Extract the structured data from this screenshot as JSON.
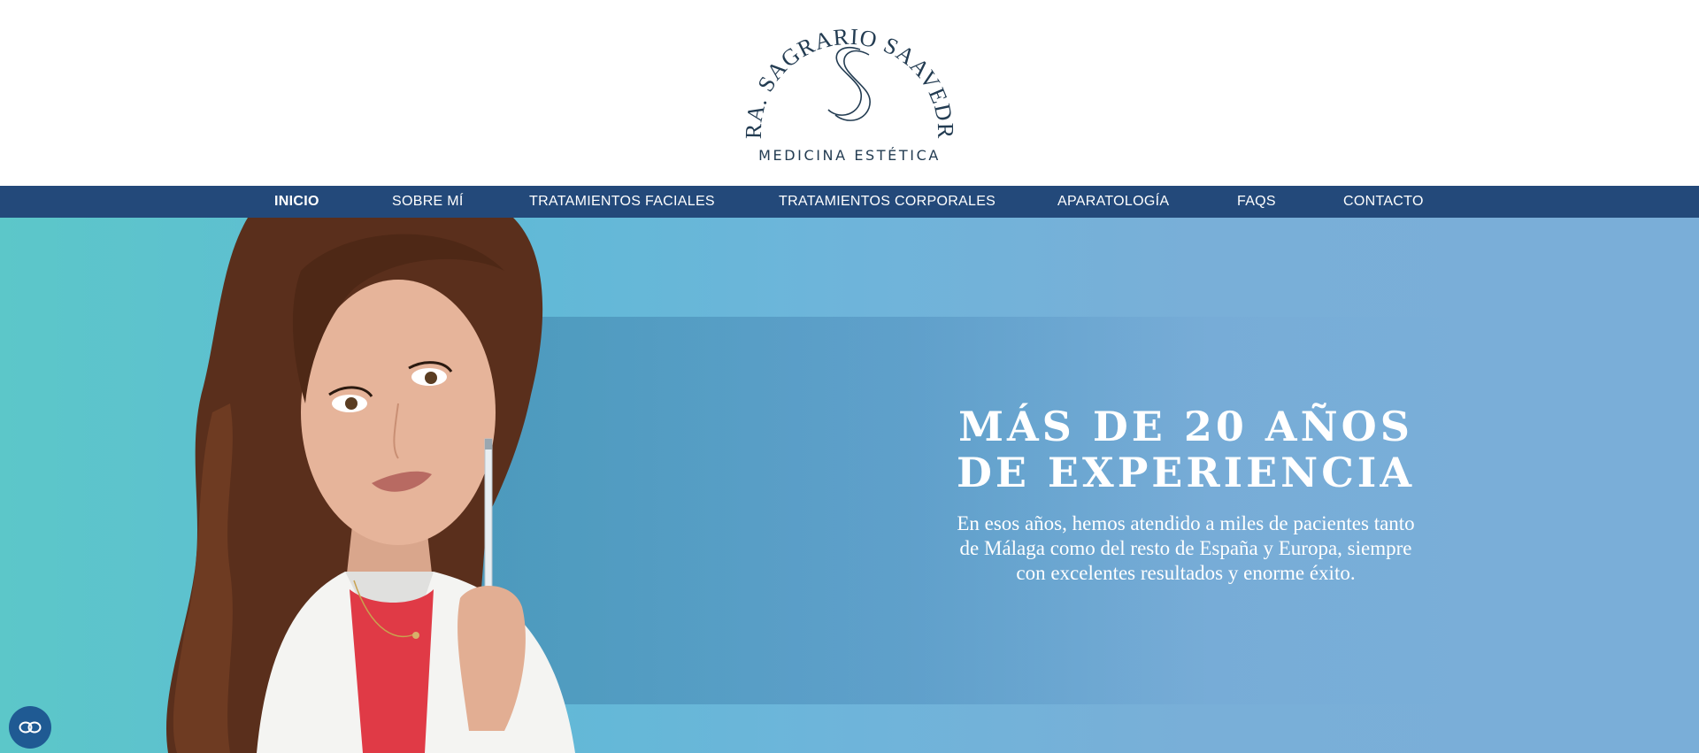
{
  "brand": {
    "name": "DRA. SAGRARIO SAAVEDRA",
    "subtitle": "MEDICINA ESTÉTICA"
  },
  "nav": {
    "items": [
      {
        "label": "INICIO",
        "active": true
      },
      {
        "label": "SOBRE MÍ"
      },
      {
        "label": "TRATAMIENTOS FACIALES"
      },
      {
        "label": "TRATAMIENTOS CORPORALES"
      },
      {
        "label": "APARATOLOGÍA"
      },
      {
        "label": "FAQS"
      },
      {
        "label": "CONTACTO"
      }
    ]
  },
  "hero": {
    "title": "MÁS DE 20 AÑOS DE EXPERIENCIA",
    "text": "En esos años, hemos atendido a miles de pacientes tanto de Málaga como del resto de España y Europa, siempre con excelentes resultados y enorme éxito."
  },
  "colors": {
    "nav_bg": "#23497a",
    "logo_ink": "#233c52",
    "hero_start": "#5cc7c9",
    "hero_end": "#7aaed8",
    "float_button": "#1f5a93"
  },
  "icons": {
    "float_button": "link-icon"
  }
}
